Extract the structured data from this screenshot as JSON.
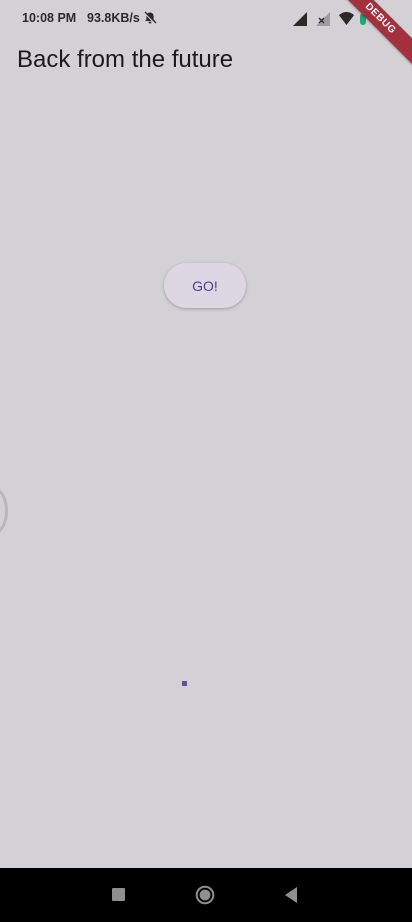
{
  "status_bar": {
    "time": "10:08 PM",
    "network_speed": "93.8KB/s",
    "icons": [
      "bell-off-icon",
      "signal-icon",
      "signal-weak-icon",
      "wifi-icon",
      "battery-icon"
    ]
  },
  "debug_banner": {
    "label": "DEBUG",
    "color": "#a3303d"
  },
  "app_bar": {
    "title": "Back from the future"
  },
  "main": {
    "go_button_label": "GO!"
  },
  "navigation_bar": {
    "icons": [
      "recents-square-icon",
      "home-circle-icon",
      "back-triangle-icon"
    ]
  },
  "colors": {
    "background": "#d3d0d6",
    "button_text": "#4b3e8c",
    "nav_bar": "#000000"
  }
}
